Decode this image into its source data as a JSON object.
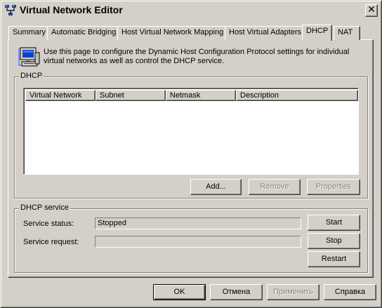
{
  "window": {
    "title": "Virtual Network Editor",
    "close_glyph": "✕"
  },
  "tabs": [
    {
      "label": "Summary"
    },
    {
      "label": "Automatic Bridging"
    },
    {
      "label": "Host Virtual Network Mapping"
    },
    {
      "label": "Host Virtual Adapters"
    },
    {
      "label": "DHCP"
    },
    {
      "label": "NAT"
    }
  ],
  "active_tab": "DHCP",
  "info": {
    "text": "Use this page to configure the Dynamic Host Configuration Protocol settings for individual virtual networks as well as control the DHCP service.",
    "icon": "computer-icon"
  },
  "dhcp_group": {
    "legend": "DHCP",
    "columns": [
      "Virtual Network",
      "Subnet",
      "Netmask",
      "Description"
    ],
    "rows": [],
    "buttons": {
      "add": "Add...",
      "remove": "Remove",
      "properties": "Properties"
    }
  },
  "service_group": {
    "legend": "DHCP service",
    "status_label": "Service status:",
    "status_value": "Stopped",
    "request_label": "Service request:",
    "request_value": "",
    "buttons": {
      "start": "Start",
      "stop": "Stop",
      "restart": "Restart"
    }
  },
  "footer": {
    "ok": "OK",
    "cancel": "Отмена",
    "apply": "Применить",
    "help": "Справка"
  }
}
